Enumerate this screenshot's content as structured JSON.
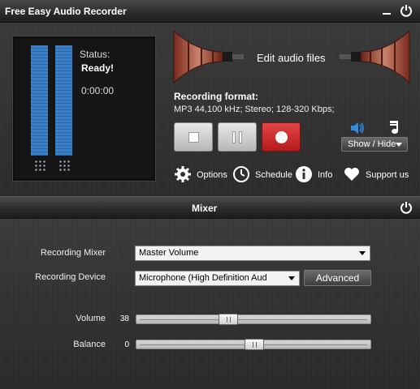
{
  "window": {
    "title": "Free Easy Audio Recorder"
  },
  "status": {
    "label": "Status:",
    "value": "Ready!",
    "timer": "0:00:00"
  },
  "edit": {
    "label": "Edit audio files"
  },
  "format": {
    "title": "Recording format:",
    "value": "MP3 44,100 kHz; Stereo;  128-320 Kbps;"
  },
  "show_hide": {
    "label": "Show / Hide"
  },
  "toolbar": {
    "options": "Options",
    "schedule": "Schedule",
    "info": "Info",
    "support": "Support us"
  },
  "mixer": {
    "title": "Mixer",
    "recording_mixer_label": "Recording Mixer",
    "recording_mixer_value": "Master Volume",
    "recording_device_label": "Recording Device",
    "recording_device_value": "Microphone (High Definition Aud",
    "advanced_label": "Advanced",
    "volume_label": "Volume",
    "volume_value": "38",
    "volume_level": 38,
    "balance_label": "Balance",
    "balance_value": "0",
    "balance_level": 0
  },
  "colors": {
    "meter_bar": "#3b7fc7",
    "record_button": "#d32f2f",
    "panel_bg": "#2f2f2f",
    "speaker_icon": "#2f8fe0"
  },
  "icons": {
    "minimize": "minimize-icon",
    "power": "power-icon",
    "stop": "stop-icon",
    "pause": "pause-icon",
    "record": "record-icon",
    "speaker": "speaker-icon",
    "music": "music-note-icon",
    "gear": "gear-icon",
    "clock": "clock-icon",
    "info": "info-icon",
    "heart": "heart-icon"
  }
}
